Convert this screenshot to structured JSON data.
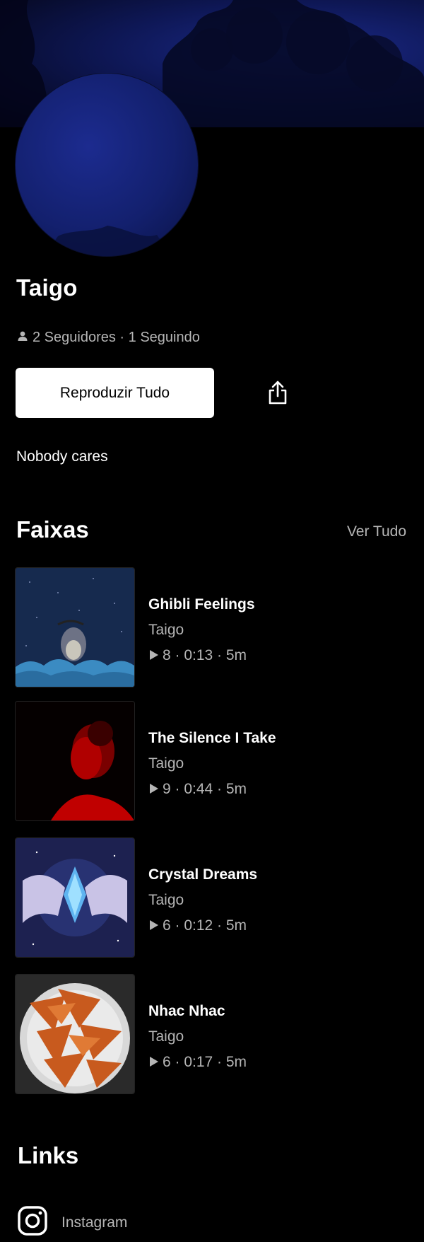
{
  "profile": {
    "name": "Taigo",
    "followers_text": "2 Seguidores · 1 Seguindo",
    "play_all_label": "Reproduzir Tudo",
    "bio": "Nobody cares"
  },
  "tracks_section": {
    "title": "Faixas",
    "see_all_label": "Ver Tudo",
    "items": [
      {
        "title": "Ghibli Feelings",
        "artist": "Taigo",
        "stats": "8 · 0:13 · 5m"
      },
      {
        "title": "The Silence I Take",
        "artist": "Taigo",
        "stats": "9 · 0:44 · 5m"
      },
      {
        "title": "Crystal Dreams",
        "artist": "Taigo",
        "stats": "6 · 0:12 · 5m"
      },
      {
        "title": "Nhac Nhac",
        "artist": "Taigo",
        "stats": "6 · 0:17 · 5m"
      }
    ]
  },
  "links_section": {
    "title": "Links",
    "items": [
      {
        "label": "Instagram",
        "icon": "instagram-icon"
      }
    ]
  },
  "colors": {
    "background": "#000000",
    "text_primary": "#ffffff",
    "text_secondary": "#b5b5b5",
    "banner": "#0e1755"
  }
}
